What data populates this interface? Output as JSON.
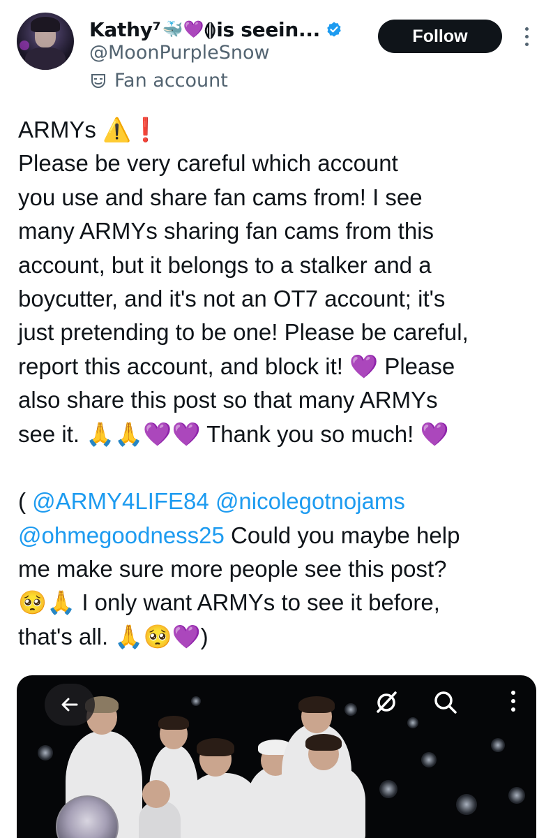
{
  "profile": {
    "display_name": "Kathy⁷",
    "name_emojis": [
      "🐳",
      "💜",
      "⟬⟭"
    ],
    "name_suffix": " is seein...",
    "handle": "@MoonPurpleSnow",
    "account_label": "Fan account",
    "follow_label": "Follow"
  },
  "tweet": {
    "lines": [
      {
        "text": "ARMYs ⚠️❗"
      },
      {
        "text": "Please be very careful which account"
      },
      {
        "text": "you use and share fan cams from! I see"
      },
      {
        "text": "many ARMYs sharing fan cams from this"
      },
      {
        "text": "account, but it belongs to a stalker and a"
      },
      {
        "text": "boycutter, and it's not an OT7 account; it's"
      },
      {
        "text": "just pretending to be one! Please be careful,"
      },
      {
        "text": "report this account, and block it! 💜 Please"
      },
      {
        "text": "also share this post so that many ARMYs"
      },
      {
        "text": "see it. 🙏🙏💜💜 Thank you so much! 💜"
      }
    ],
    "mention_line1": {
      "prefix": "( ",
      "m1": "@ARMY4LIFE84",
      "sep": " ",
      "m2": "@nicolegotnojams"
    },
    "mention_line2": {
      "m3": "@ohmegoodness25",
      "rest": " Could you maybe help"
    },
    "tail_lines": [
      {
        "text": "me make sure more people see this post?"
      },
      {
        "text": "🥺🙏 I only want ARMYs to see it before,"
      },
      {
        "text": "that's all. 🙏🥺💜)"
      }
    ]
  },
  "media": {
    "back_icon": "arrow-left-icon",
    "hide_icon": "eye-slash-icon",
    "search_icon": "search-icon",
    "more_icon": "vertical-dots-icon"
  },
  "colors": {
    "text": "#0f1419",
    "secondary": "#536471",
    "link": "#1d9bf0",
    "verified": "#1d9bf0",
    "follow_bg": "#0f1419"
  }
}
